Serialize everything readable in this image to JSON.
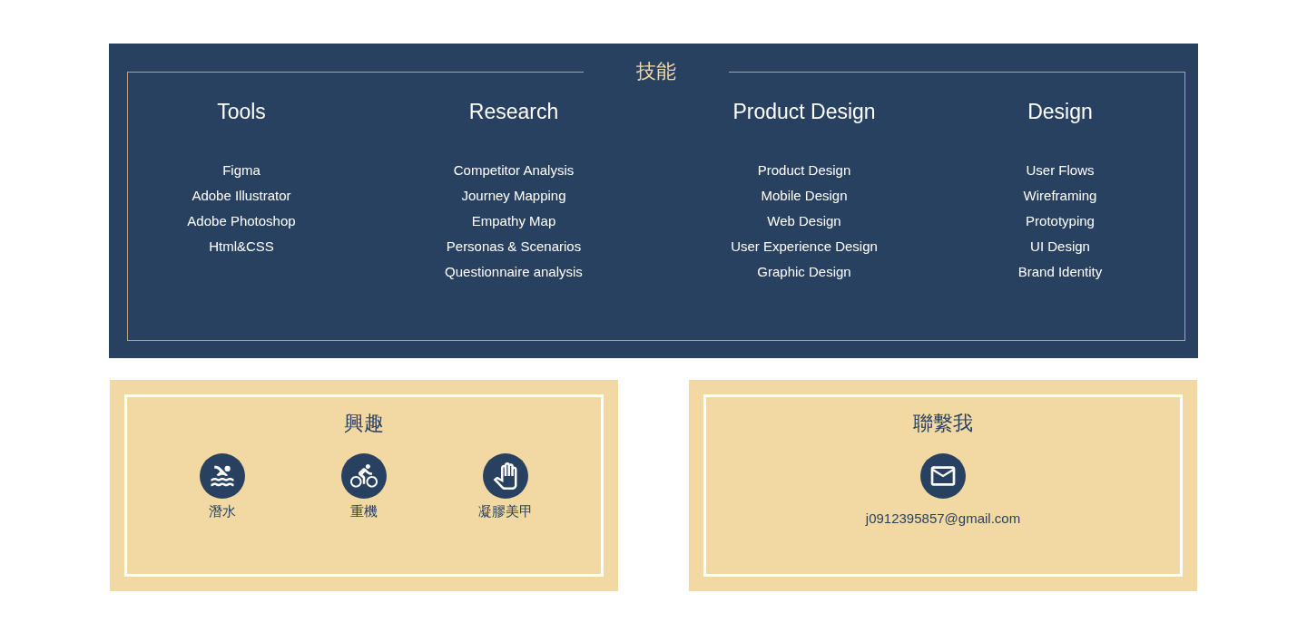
{
  "skills": {
    "title": "技能",
    "columns": [
      {
        "heading": "Tools",
        "items": [
          "Figma",
          "Adobe Illustrator",
          "Adobe Photoshop",
          "Html&CSS"
        ]
      },
      {
        "heading": "Research",
        "items": [
          "Competitor Analysis",
          "Journey Mapping",
          "Empathy Map",
          "Personas & Scenarios",
          "Questionnaire analysis"
        ]
      },
      {
        "heading": "Product Design",
        "items": [
          "Product Design",
          "Mobile Design",
          "Web Design",
          "User Experience Design",
          "Graphic Design"
        ]
      },
      {
        "heading": "Design",
        "items": [
          "User Flows",
          "Wireframing",
          "Prototyping",
          "UI Design",
          "Brand Identity"
        ]
      }
    ]
  },
  "interests": {
    "title": "興趣",
    "items": [
      {
        "kind": "swim",
        "label": "潛水"
      },
      {
        "kind": "bike",
        "label": "重機"
      },
      {
        "kind": "hand",
        "label": "凝膠美甲"
      }
    ]
  },
  "contact": {
    "title": "聯繫我",
    "email": "j0912395857@gmail.com"
  }
}
